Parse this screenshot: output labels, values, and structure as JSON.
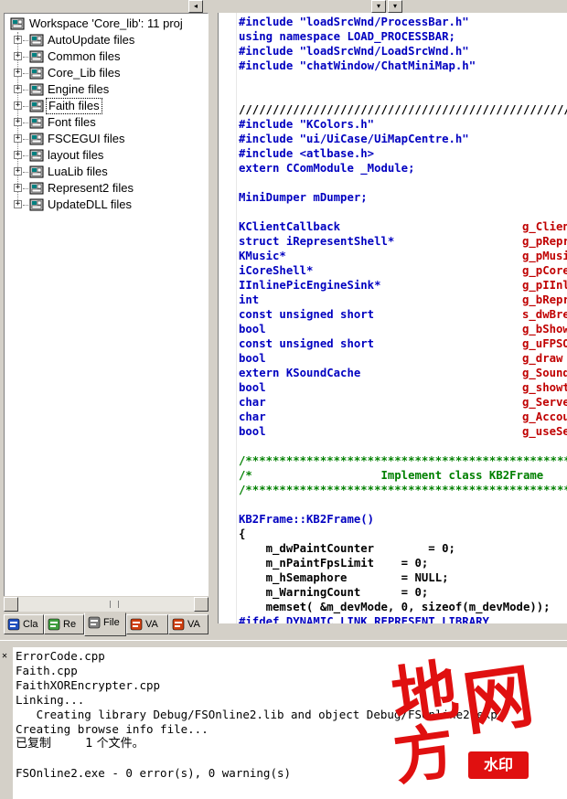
{
  "workspace": {
    "root_label": "Workspace 'Core_lib': 11 proj",
    "projects": [
      {
        "label": "AutoUpdate files"
      },
      {
        "label": "Common files"
      },
      {
        "label": "Core_Lib files"
      },
      {
        "label": "Engine files"
      },
      {
        "label": "Faith files",
        "selected": true
      },
      {
        "label": "Font files"
      },
      {
        "label": "FSCEGUI files"
      },
      {
        "label": "layout files"
      },
      {
        "label": "LuaLib files"
      },
      {
        "label": "Represent2 files"
      },
      {
        "label": "UpdateDLL files"
      }
    ]
  },
  "tabs": [
    {
      "label": "Cla",
      "icon": "class-view-icon"
    },
    {
      "label": "Re",
      "icon": "resource-view-icon"
    },
    {
      "label": "File",
      "icon": "file-view-icon",
      "active": true
    },
    {
      "label": "VA",
      "icon": "visual-assist-tomato-icon"
    },
    {
      "label": "VA",
      "icon": "visual-assist-tomato-icon-2"
    }
  ],
  "editor": {
    "lines": [
      {
        "a": "#include \"loadSrcWnd/ProcessBar.h\"",
        "style": "inc"
      },
      {
        "a": "using namespace LOAD_PROCESSBAR;",
        "style": "ns"
      },
      {
        "a": "#include \"loadSrcWnd/LoadSrcWnd.h\"",
        "style": "inc"
      },
      {
        "a": "#include \"chatWindow/ChatMiniMap.h\"",
        "style": "inc"
      },
      {
        "a": "",
        "style": "blank"
      },
      {
        "a": "",
        "style": "blank"
      },
      {
        "a": "////////////////////////////////////////////////////////",
        "style": "plain"
      },
      {
        "a": "#include \"KColors.h\"",
        "style": "inc"
      },
      {
        "a": "#include \"ui/UiCase/UiMapCentre.h\"",
        "style": "inc"
      },
      {
        "a": "#include <atlbase.h>",
        "style": "inc"
      },
      {
        "a": "extern CComModule _Module;",
        "style": "ext"
      },
      {
        "a": "",
        "style": "blank"
      },
      {
        "a": "MiniDumper mDumper;",
        "style": "decl"
      },
      {
        "a": "",
        "style": "blank"
      },
      {
        "a": "KClientCallback",
        "b": "g_ClientC",
        "style": "pair"
      },
      {
        "a": "struct iRepresentShell*",
        "b": "g_pRepres",
        "style": "pair"
      },
      {
        "a": "KMusic*",
        "b": "g_pMusicS",
        "style": "pair"
      },
      {
        "a": "iCoreShell*",
        "b": "g_pCoreSh",
        "style": "pair"
      },
      {
        "a": "IInlinePicEngineSink*",
        "b": "g_pIInlin",
        "style": "pair"
      },
      {
        "a": "int",
        "b": "g_bRepres",
        "style": "pair"
      },
      {
        "a": "const unsigned short",
        "b": "s_dwBreat",
        "style": "pair"
      },
      {
        "a": "bool",
        "b": "g_bShowFP",
        "style": "pair"
      },
      {
        "a": "const unsigned short",
        "b": "g_uFPSOpt",
        "style": "pair"
      },
      {
        "a": "bool",
        "b": "g_draw",
        "style": "pair"
      },
      {
        "a": "extern KSoundCache",
        "b": "g_SoundCa",
        "style": "pair"
      },
      {
        "a": "bool",
        "b": "g_showtip",
        "style": "pair"
      },
      {
        "a": "char",
        "b": "g_ServerI",
        "style": "pair"
      },
      {
        "a": "char",
        "b": "g_Account",
        "style": "pair"
      },
      {
        "a": "bool",
        "b": "g_useServ",
        "style": "pair"
      },
      {
        "a": "",
        "style": "blank"
      },
      {
        "a": "/*****************************************************",
        "style": "cmt"
      },
      {
        "a": "/*                   Implement class KB2Frame",
        "style": "cmt"
      },
      {
        "a": "/*****************************************************",
        "style": "cmt"
      },
      {
        "a": "",
        "style": "blank"
      },
      {
        "a": "KB2Frame::KB2Frame()",
        "style": "fn"
      },
      {
        "a": "{",
        "style": "plain"
      },
      {
        "a": "    m_dwPaintCounter        = 0;",
        "style": "body"
      },
      {
        "a": "    m_nPaintFpsLimit    = 0;",
        "style": "body"
      },
      {
        "a": "    m_hSemaphore        = NULL;",
        "style": "body"
      },
      {
        "a": "    m_WarningCount      = 0;",
        "style": "body"
      },
      {
        "a": "    memset( &m_devMode, 0, sizeof(m_devMode));",
        "style": "memset"
      },
      {
        "a": "#ifdef DYNAMIC_LINK_REPRESENT_LIBRARY",
        "style": "cut"
      }
    ]
  },
  "output": {
    "lines": [
      "ErrorCode.cpp",
      "Faith.cpp",
      "FaithXOREncrypter.cpp",
      "Linking...",
      "   Creating library Debug/FSOnline2.lib and object Debug/FSOnline2.exp",
      "Creating browse info file...",
      "已复制         1 个文件。",
      "",
      "FSOnline2.exe - 0 error(s), 0 warning(s)"
    ]
  },
  "watermark": {
    "chars": [
      "地",
      "网",
      "方"
    ],
    "badge": "水印"
  },
  "colors": {
    "keyword": "#0000c0",
    "identifier_right": "#c00000",
    "comment": "#008000",
    "chrome": "#d4d0c8",
    "watermark": "#e01010"
  }
}
